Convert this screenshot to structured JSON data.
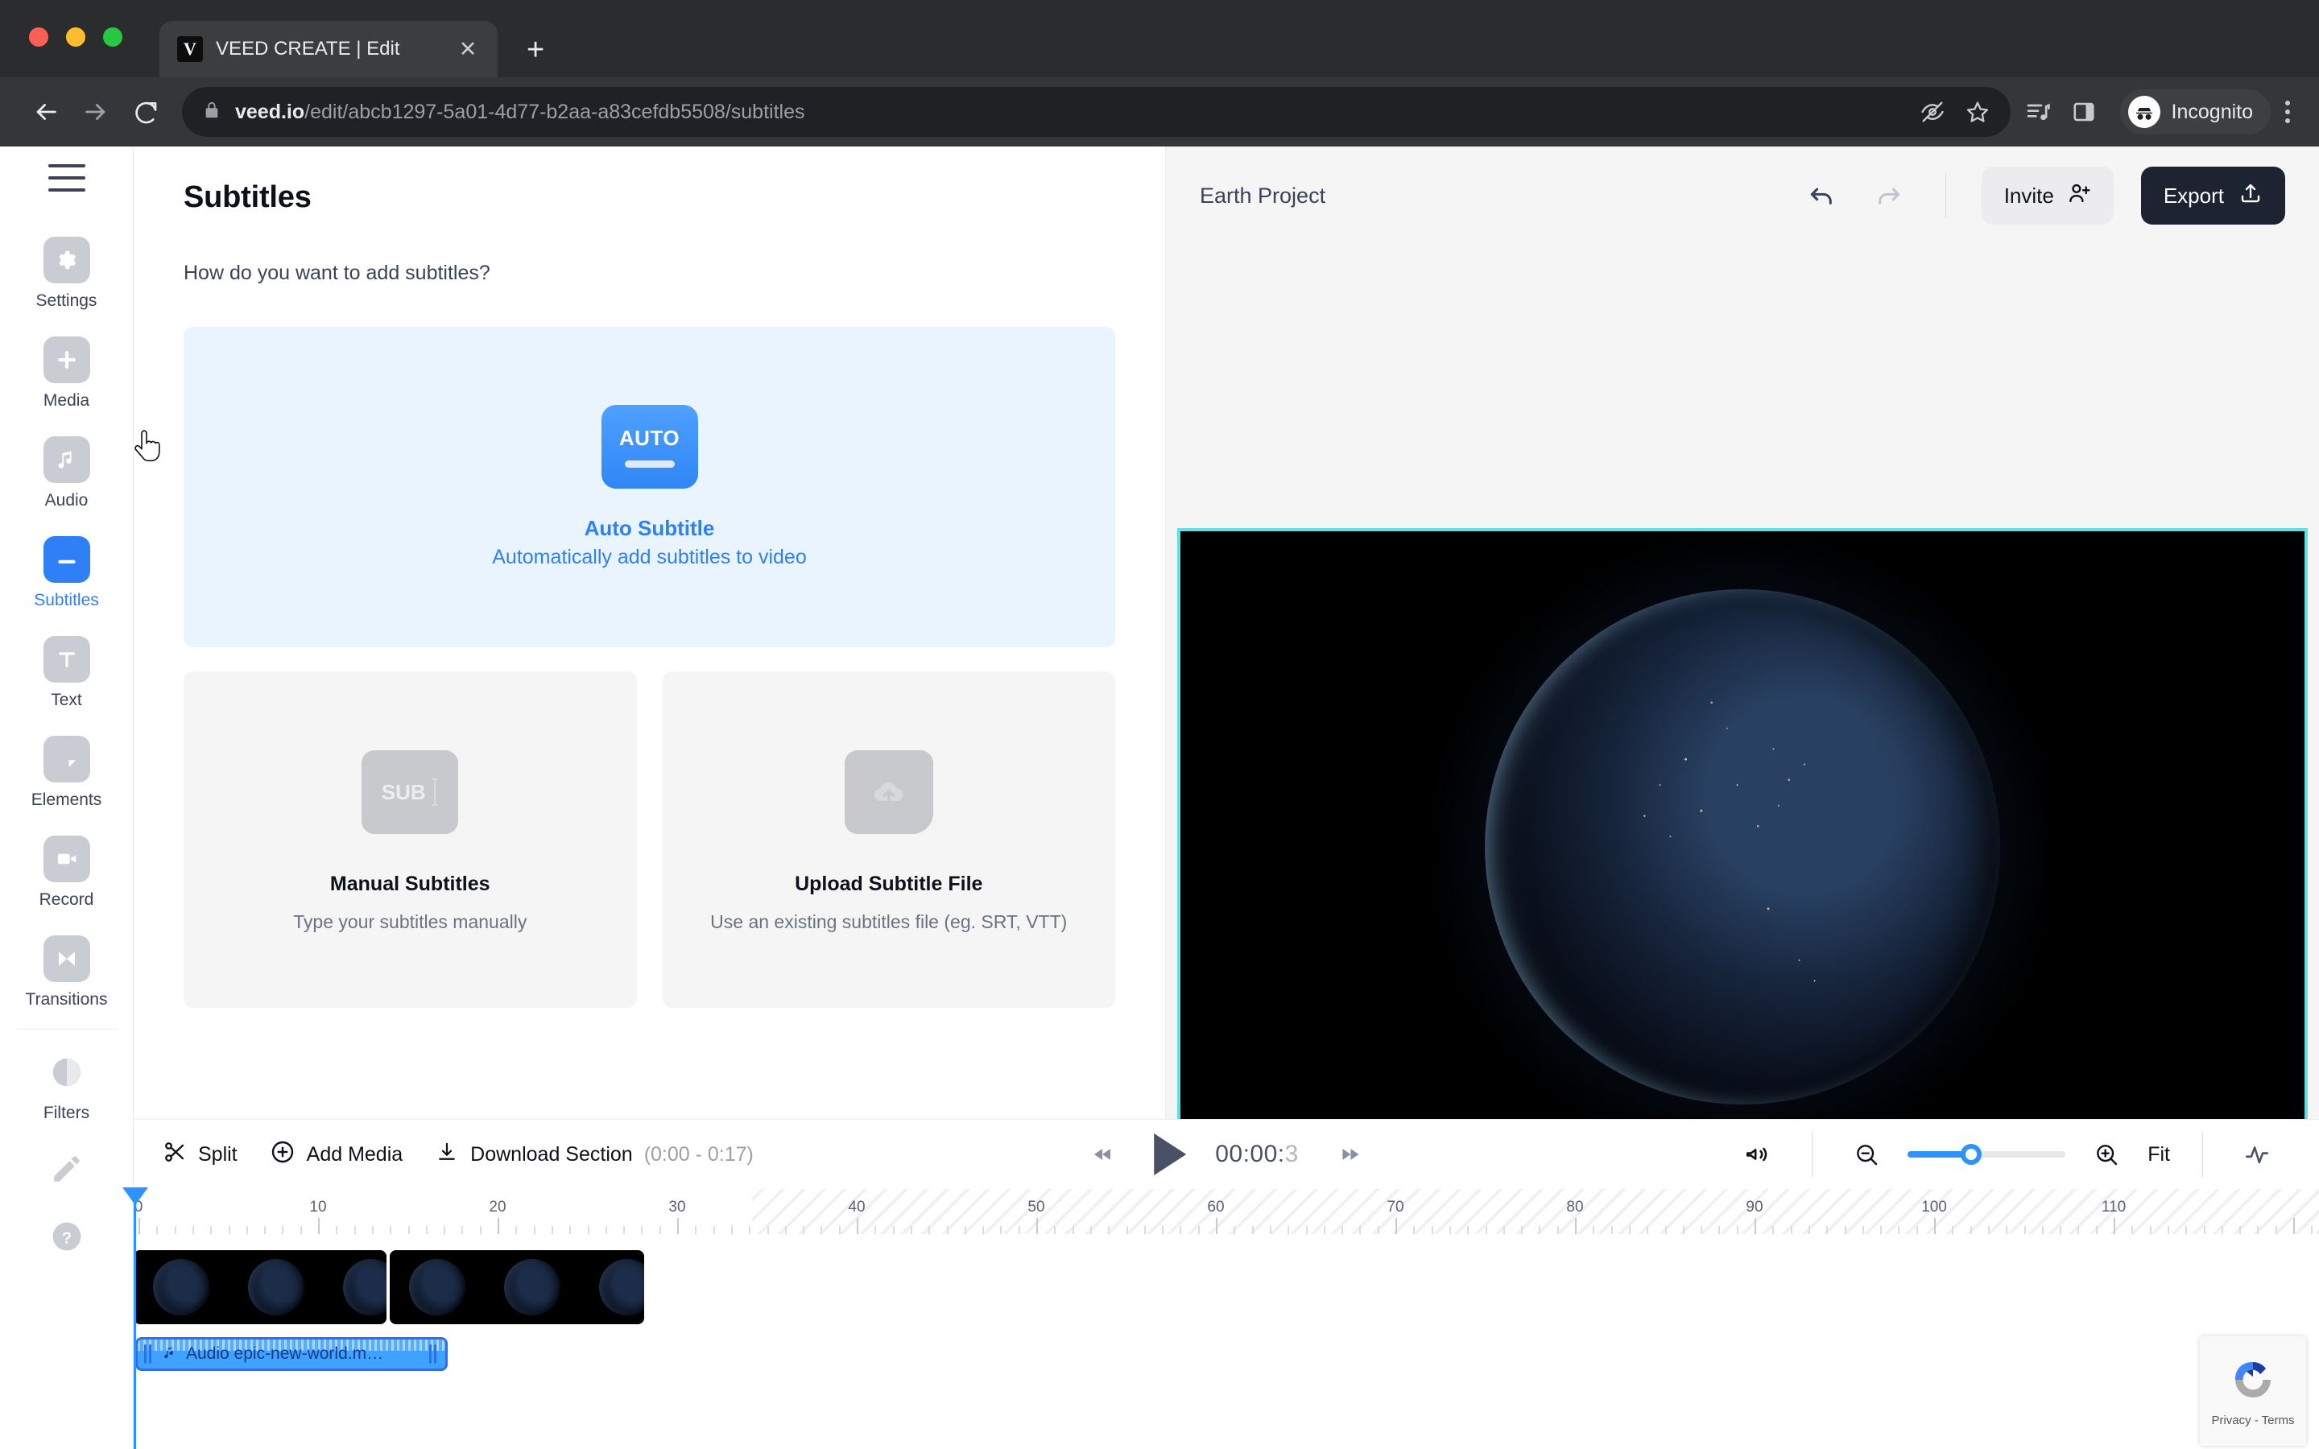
{
  "browser": {
    "tab": {
      "title": "VEED CREATE | Edit",
      "favicon_letter": "V",
      "close_icon": "close-icon"
    },
    "new_tab_glyph": "+",
    "url": {
      "host": "veed.io",
      "path": "/edit/abcb1297-5a01-4d77-b2aa-a83cefdb5508/subtitles"
    },
    "profile_label": "Incognito",
    "icons": [
      "back-icon",
      "forward-icon",
      "reload-icon",
      "lock-icon",
      "hide-icon",
      "bookmark-star-icon",
      "media-list-icon",
      "side-panel-icon",
      "incognito-icon",
      "kebab-menu-icon"
    ]
  },
  "rail": {
    "menu_icon": "hamburger-icon",
    "items": [
      {
        "label": "Settings",
        "icon": "gear-icon",
        "active": false
      },
      {
        "label": "Media",
        "icon": "plus-square-icon",
        "active": false
      },
      {
        "label": "Audio",
        "icon": "music-note-icon",
        "active": false
      },
      {
        "label": "Subtitles",
        "icon": "subtitles-icon",
        "active": true
      },
      {
        "label": "Text",
        "icon": "text-t-icon",
        "active": false
      },
      {
        "label": "Elements",
        "icon": "shapes-icon",
        "active": false
      },
      {
        "label": "Record",
        "icon": "video-camera-icon",
        "active": false
      },
      {
        "label": "Transitions",
        "icon": "transitions-icon",
        "active": false
      },
      {
        "label": "Filters",
        "icon": "contrast-circle-icon",
        "active": false
      }
    ],
    "extra": [
      {
        "icon": "pencil-icon"
      },
      {
        "icon": "help-question-icon"
      }
    ]
  },
  "panel": {
    "title": "Subtitles",
    "question": "How do you want to add subtitles?",
    "auto": {
      "badge_text": "AUTO",
      "title": "Auto Subtitle",
      "subtitle": "Automatically add subtitles to video"
    },
    "options": [
      {
        "icon_text": "SUB",
        "icon": "subtitle-type-icon",
        "title": "Manual Subtitles",
        "subtitle": "Type your subtitles manually"
      },
      {
        "icon_text": "",
        "icon": "upload-file-icon",
        "title": "Upload Subtitle File",
        "subtitle": "Use an existing subtitles file (eg. SRT, VTT)"
      }
    ]
  },
  "stage": {
    "project_name": "Earth Project",
    "undo_icon": "undo-arrow-icon",
    "redo_icon": "redo-arrow-icon",
    "invite_label": "Invite",
    "invite_icon": "add-person-icon",
    "export_label": "Export",
    "export_icon": "upload-arrow-icon",
    "canvas_border_color": "#5ce1e6"
  },
  "timeline": {
    "split_label": "Split",
    "split_icon": "scissors-icon",
    "add_media_label": "Add Media",
    "add_media_icon": "plus-circle-icon",
    "download_label": "Download Section",
    "download_range": "(0:00 - 0:17)",
    "download_icon": "download-icon",
    "skip_back_icon": "skip-back-icon",
    "play_icon": "play-icon",
    "skip_forward_icon": "skip-forward-icon",
    "current_time": "00:00:",
    "current_time_faint": "3",
    "volume_icon": "speaker-icon",
    "zoom_out_icon": "zoom-out-icon",
    "zoom_in_icon": "zoom-in-icon",
    "fit_label": "Fit",
    "waveform_icon": "waveform-icon",
    "zoom_percent": 40,
    "ruler_labels": [
      "0",
      "10",
      "20",
      "30",
      "40",
      "50",
      "60",
      "70",
      "80",
      "90",
      "100",
      "110"
    ],
    "audio_clip_label": "Audio epic-new-world.m…",
    "audio_clip_icon": "music-note-icon",
    "playhead_position": "0"
  },
  "recaptcha": {
    "label": "Privacy - Terms",
    "icon": "recaptcha-icon"
  }
}
